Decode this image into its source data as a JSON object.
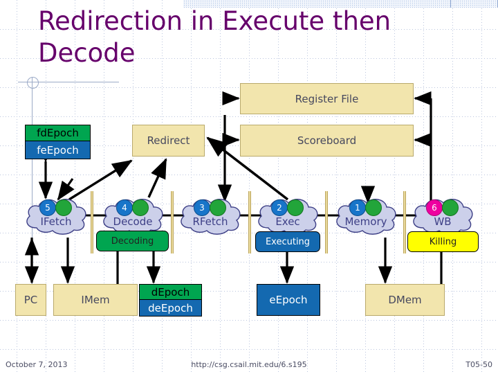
{
  "slide": {
    "title": "Redirection in Execute then Decode",
    "footer": {
      "date": "October 7, 2013",
      "url": "http://csg.csail.mit.edu/6.s195",
      "slide_id": "T05-50"
    }
  },
  "colors": {
    "title": "#66006b",
    "tan_fill": "#f2e5ad",
    "tan_border": "#b9a96b",
    "green": "#00a550",
    "blue": "#1469b0",
    "yellow": "#ffff00",
    "cloud_fill": "#ccd0ea",
    "cloud_border": "#3d3f86",
    "dot_blue": "#1875c9",
    "dot_green": "#22a53a",
    "dot_pink": "#ee00a0",
    "label_text": "#46485e"
  },
  "top_boxes": {
    "register_file": "Register File",
    "scoreboard": "Scoreboard",
    "redirect": "Redirect"
  },
  "epoch_registers": {
    "left_stack": [
      {
        "label": "fdEpoch",
        "fill": "#00a550",
        "text": "#000000"
      },
      {
        "label": "feEpoch",
        "fill": "#1469b0",
        "text": "#ffffff"
      }
    ],
    "mid_stack": [
      {
        "label": "dEpoch",
        "fill": "#00a550",
        "text": "#000000"
      },
      {
        "label": "deEpoch",
        "fill": "#1469b0",
        "text": "#ffffff"
      }
    ],
    "e_epoch": {
      "label": "eEpoch",
      "fill": "#1469b0",
      "text": "#ffffff"
    }
  },
  "stages": [
    {
      "name": "IFetch",
      "number": "5",
      "number_color": "blue",
      "green_dot": true
    },
    {
      "name": "Decode",
      "number": "4",
      "number_color": "blue",
      "green_dot": true
    },
    {
      "name": "RFetch",
      "number": "3",
      "number_color": "blue",
      "green_dot": true
    },
    {
      "name": "Exec",
      "number": "2",
      "number_color": "blue",
      "green_dot": true
    },
    {
      "name": "Memory",
      "number": "1",
      "number_color": "blue",
      "green_dot": true
    },
    {
      "name": "WB",
      "number": "6",
      "number_color": "pink",
      "green_dot": true
    }
  ],
  "status_pills": [
    {
      "label": "Decoding",
      "style": "green",
      "stage": "Decode"
    },
    {
      "label": "Executing",
      "style": "blue",
      "stage": "Exec"
    },
    {
      "label": "Killing",
      "style": "yellow",
      "stage": "WB"
    }
  ],
  "bottom_boxes": {
    "pc": "PC",
    "imem": "IMem",
    "dmem": "DMem"
  }
}
